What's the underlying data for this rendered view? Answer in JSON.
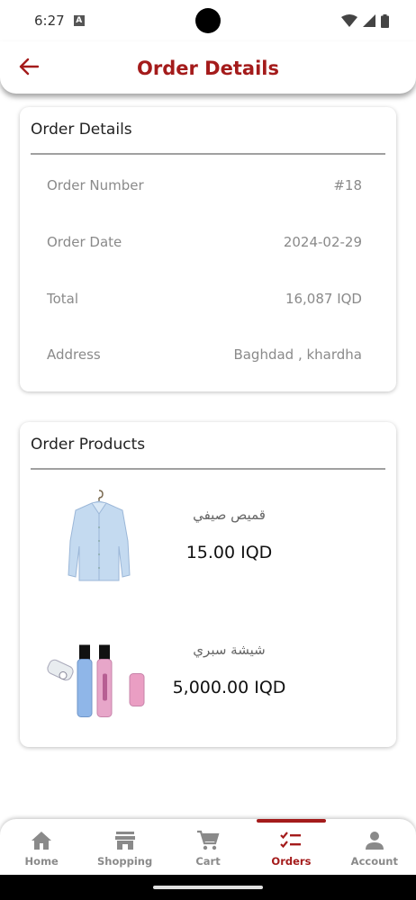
{
  "status_bar": {
    "time": "6:27",
    "notification_badge": "A",
    "icons": [
      "wifi-icon",
      "signal-icon",
      "battery-icon"
    ]
  },
  "app_bar": {
    "title": "Order Details",
    "back_icon": "arrow-back-icon"
  },
  "order_details": {
    "title": "Order Details",
    "rows": [
      {
        "label": "Order Number",
        "value": "#18"
      },
      {
        "label": "Order Date",
        "value": "2024-02-29"
      },
      {
        "label": "Total",
        "value": "16,087 IQD"
      },
      {
        "label": "Address",
        "value": "Baghdad , khardha"
      }
    ]
  },
  "order_products": {
    "title": "Order Products",
    "items": [
      {
        "name": "قميص صيفي",
        "price": "15.00 IQD",
        "image": "shirt-image"
      },
      {
        "name": "شيشة سبري",
        "price": "5,000.00 IQD",
        "image": "perfume-bottles-image"
      }
    ]
  },
  "bottom_nav": {
    "items": [
      {
        "label": "Home",
        "icon": "home-icon",
        "active": false
      },
      {
        "label": "Shopping",
        "icon": "store-icon",
        "active": false
      },
      {
        "label": "Cart",
        "icon": "cart-icon",
        "active": false
      },
      {
        "label": "Orders",
        "icon": "checklist-icon",
        "active": true
      },
      {
        "label": "Account",
        "icon": "person-icon",
        "active": false
      }
    ]
  },
  "colors": {
    "accent": "#a41b1b",
    "muted_text": "#8a8a8a"
  }
}
